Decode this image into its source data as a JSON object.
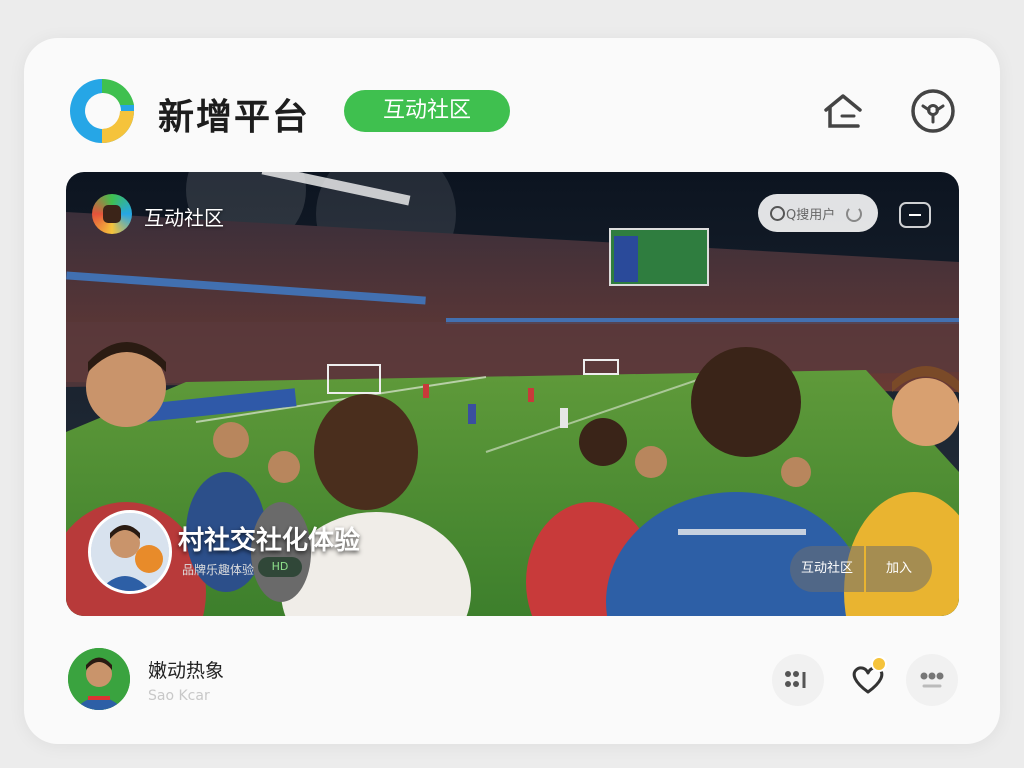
{
  "header": {
    "app_title": "新增平台",
    "badge_label": "互动社区",
    "home_icon": "home-icon",
    "user_icon": "user-circle-icon"
  },
  "hero": {
    "brand_label": "互动社区",
    "search_placeholder": "Q搜用户",
    "title": "村社交社化体验",
    "subtitle": "品牌乐趣体验",
    "tag": "HD",
    "left_button": "互动社区",
    "right_button": "加入"
  },
  "footer": {
    "user_name": "嫩动热象",
    "user_handle": "Sao Kcar"
  },
  "colors": {
    "accent_green": "#3fc04f",
    "logo_blue": "#26a6e6",
    "logo_yellow": "#f5c33b"
  }
}
